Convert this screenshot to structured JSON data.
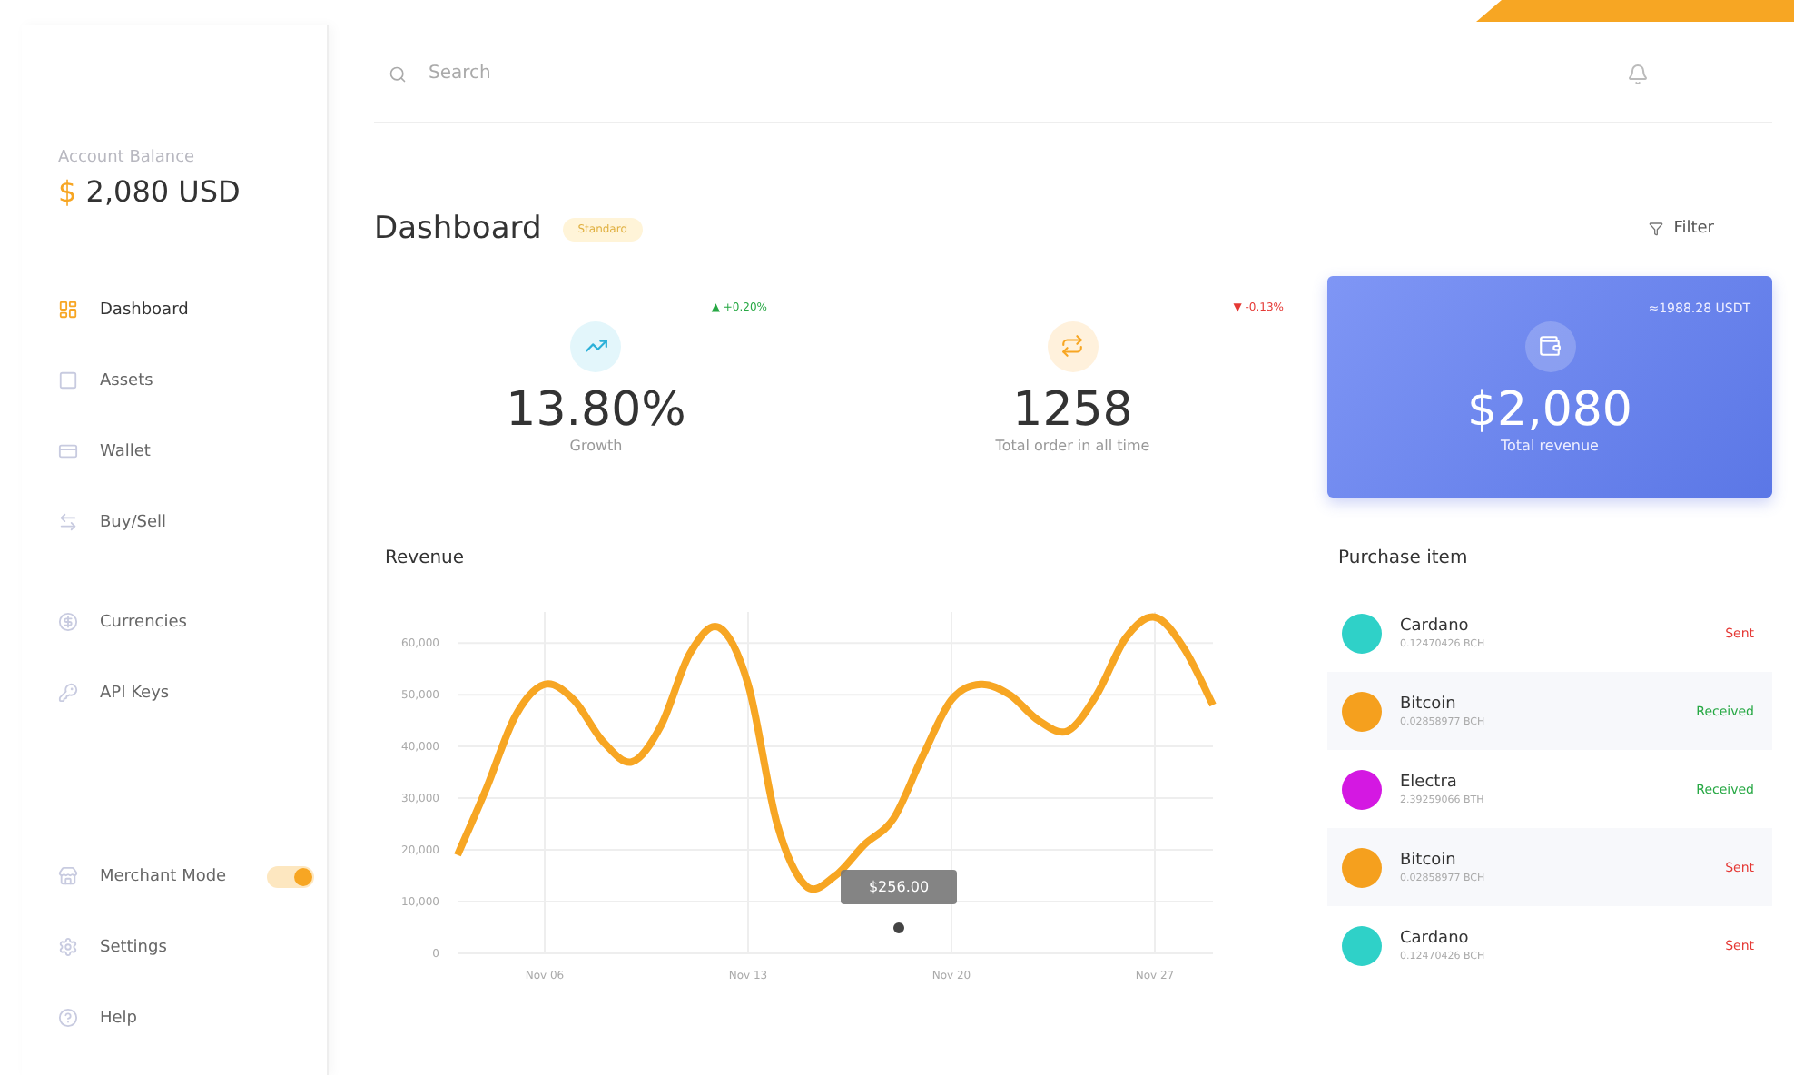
{
  "sidebar": {
    "balance_label": "Account Balance",
    "balance_currency": "$",
    "balance_value": "2,080 USD",
    "items": [
      {
        "label": "Dashboard",
        "selected": true
      },
      {
        "label": "Assets",
        "selected": false
      },
      {
        "label": "Wallet",
        "selected": false
      },
      {
        "label": "Buy/Sell",
        "selected": false
      },
      {
        "label": "Currencies",
        "selected": false
      },
      {
        "label": "API Keys",
        "selected": false
      }
    ],
    "bottom_items": [
      {
        "label": "Merchant Mode",
        "kind": "toggle",
        "on": true
      },
      {
        "label": "Settings",
        "kind": "link"
      },
      {
        "label": "Help",
        "kind": "link"
      }
    ]
  },
  "search": {
    "placeholder": "Search"
  },
  "header": {
    "title": "Dashboard",
    "badge": "Standard",
    "filter": "Filter"
  },
  "stats": [
    {
      "kind": "up",
      "value": "13.80%",
      "label": "Growth",
      "arrow": "▲",
      "change": "+0.20%"
    },
    {
      "kind": "down",
      "value": "1258",
      "label": "Total order in all time",
      "arrow": "▼",
      "change": "-0.13%"
    },
    {
      "kind": "highlight",
      "value": "$2,080",
      "label": "Total revenue",
      "note": "≈1988.28 USDT"
    }
  ],
  "revenue": {
    "title": "Revenue",
    "tooltip": "$256.00",
    "chart_data": {
      "type": "line",
      "categories": [
        null,
        null,
        null,
        "Nov 06",
        null,
        null,
        null,
        null,
        null,
        null,
        "Nov 13",
        null,
        null,
        null,
        null,
        null,
        null,
        "Nov 20",
        null,
        null,
        null,
        null,
        null,
        null,
        "Nov 27",
        null,
        null
      ],
      "series": [
        {
          "color": "#f7a623",
          "values": [
            19000,
            32000,
            46000,
            52000,
            49000,
            41000,
            37000,
            44000,
            58000,
            63000,
            52000,
            25000,
            13000,
            15000,
            21000,
            26000,
            38000,
            49000,
            52000,
            50000,
            45000,
            43000,
            50000,
            61000,
            65000,
            59000,
            48000
          ]
        }
      ],
      "ylim": [
        0,
        66000
      ],
      "grid": true,
      "yticks": [
        {
          "value": 0,
          "label": "0"
        },
        {
          "value": 10000,
          "label": "10,000"
        },
        {
          "value": 20000,
          "label": "20,000"
        },
        {
          "value": 30000,
          "label": "30,000"
        },
        {
          "value": 40000,
          "label": "40,000"
        },
        {
          "value": 50000,
          "label": "50,000"
        },
        {
          "value": 60000,
          "label": "60,000"
        }
      ]
    }
  },
  "purchases": {
    "title": "Purchase item",
    "items": [
      {
        "name": "Cardano",
        "amount": "0.12470426 BCH",
        "status": "Sent",
        "kind": "sent",
        "color": "#2fd1c8"
      },
      {
        "name": "Bitcoin",
        "amount": "0.02858977 BCH",
        "status": "Received",
        "kind": "received",
        "color": "#f5a01e"
      },
      {
        "name": "Electra",
        "amount": "2.39259066 BTH",
        "status": "Received",
        "kind": "received",
        "color": "#d418e2"
      },
      {
        "name": "Bitcoin",
        "amount": "0.02858977 BCH",
        "status": "Sent",
        "kind": "sent",
        "color": "#f5a01e"
      },
      {
        "name": "Cardano",
        "amount": "0.12470426 BCH",
        "status": "Sent",
        "kind": "sent",
        "color": "#2fd1c8"
      }
    ]
  }
}
